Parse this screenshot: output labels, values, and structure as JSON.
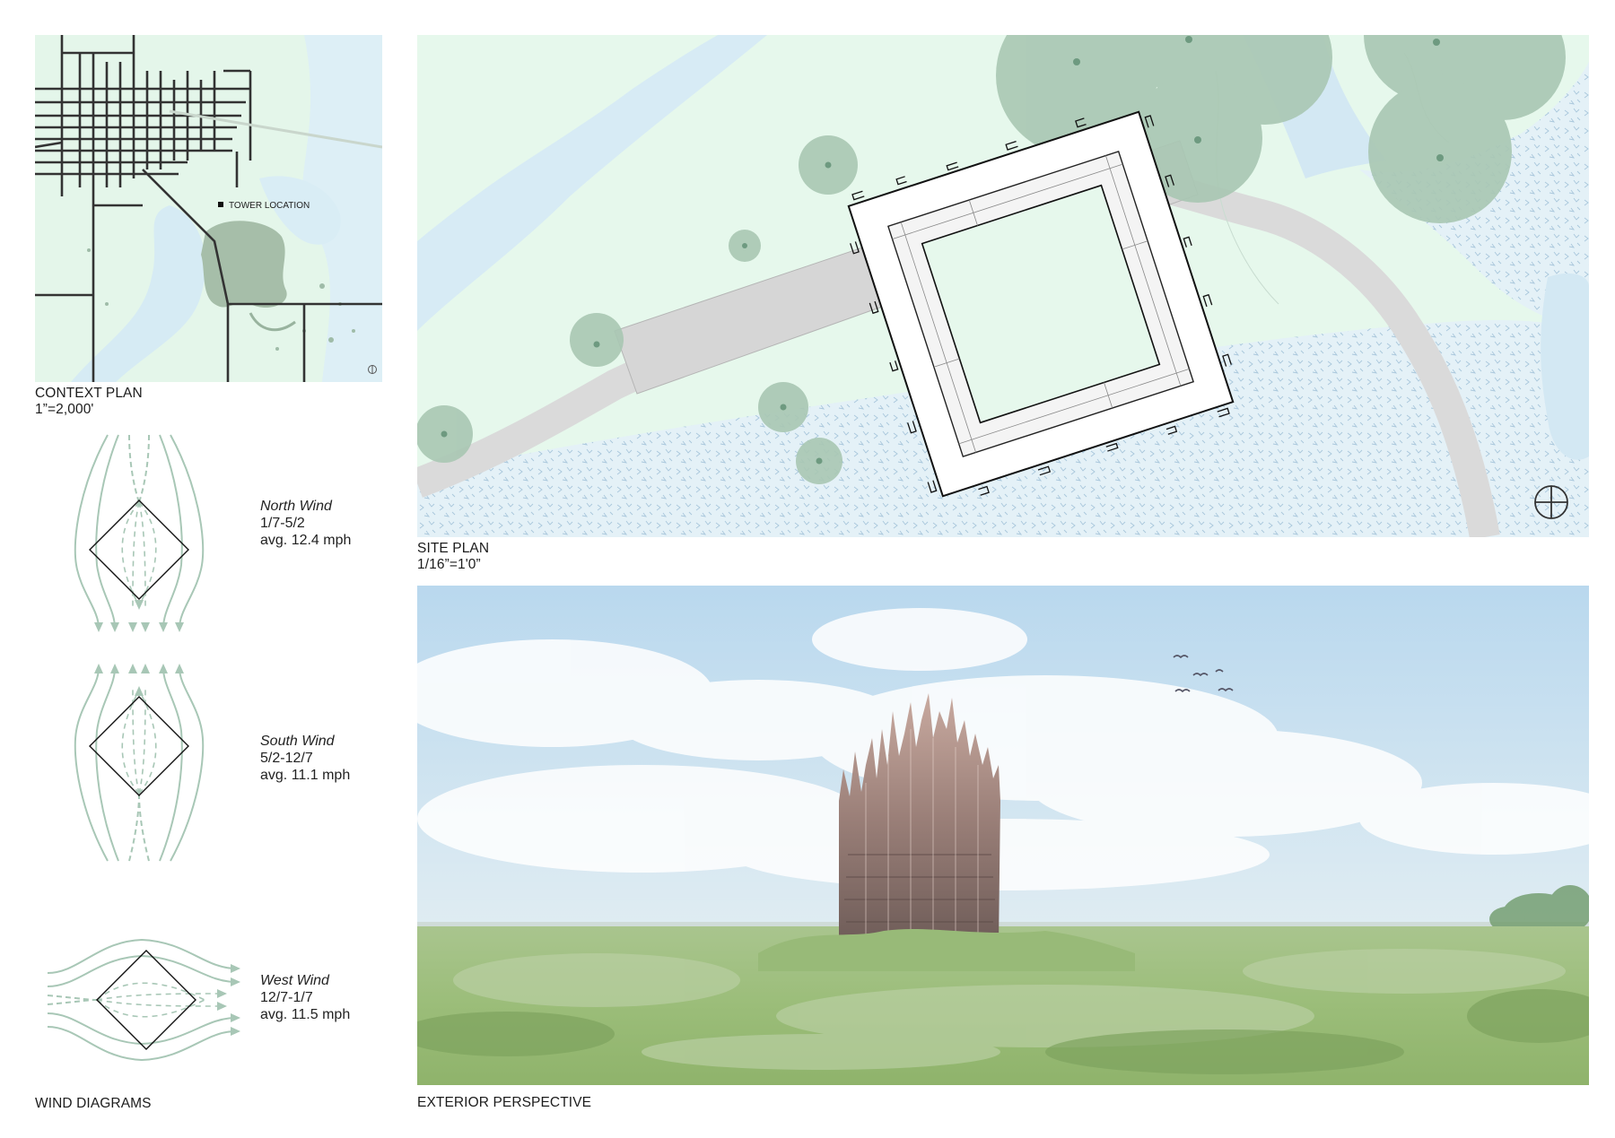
{
  "context_plan": {
    "tower_location_label": "TOWER LOCATION",
    "caption_title": "CONTEXT PLAN",
    "caption_scale": "1”=2,000'",
    "north_icon": "north-arrow-icon"
  },
  "site_plan": {
    "caption_title": "SITE PLAN",
    "caption_scale": "1/16”=1'0”",
    "north_icon": "north-arrow-icon"
  },
  "wind_diagrams": {
    "caption_title": "WIND DIAGRAMS",
    "items": [
      {
        "name": "North Wind",
        "dates": "1/7-5/2",
        "avg": "avg. 12.4 mph"
      },
      {
        "name": "South Wind",
        "dates": "5/2-12/7",
        "avg": "avg. 11.1 mph"
      },
      {
        "name": "West Wind",
        "dates": "12/7-1/7",
        "avg": "avg. 11.5 mph"
      }
    ]
  },
  "exterior_perspective": {
    "caption_title": "EXTERIOR PERSPECTIVE"
  },
  "colors": {
    "land": "#e6f8ec",
    "water": "#d7ebf5",
    "tree": "#a9c7b3",
    "path": "#d9d9d9",
    "wind_lines": "#a8c7b6"
  }
}
